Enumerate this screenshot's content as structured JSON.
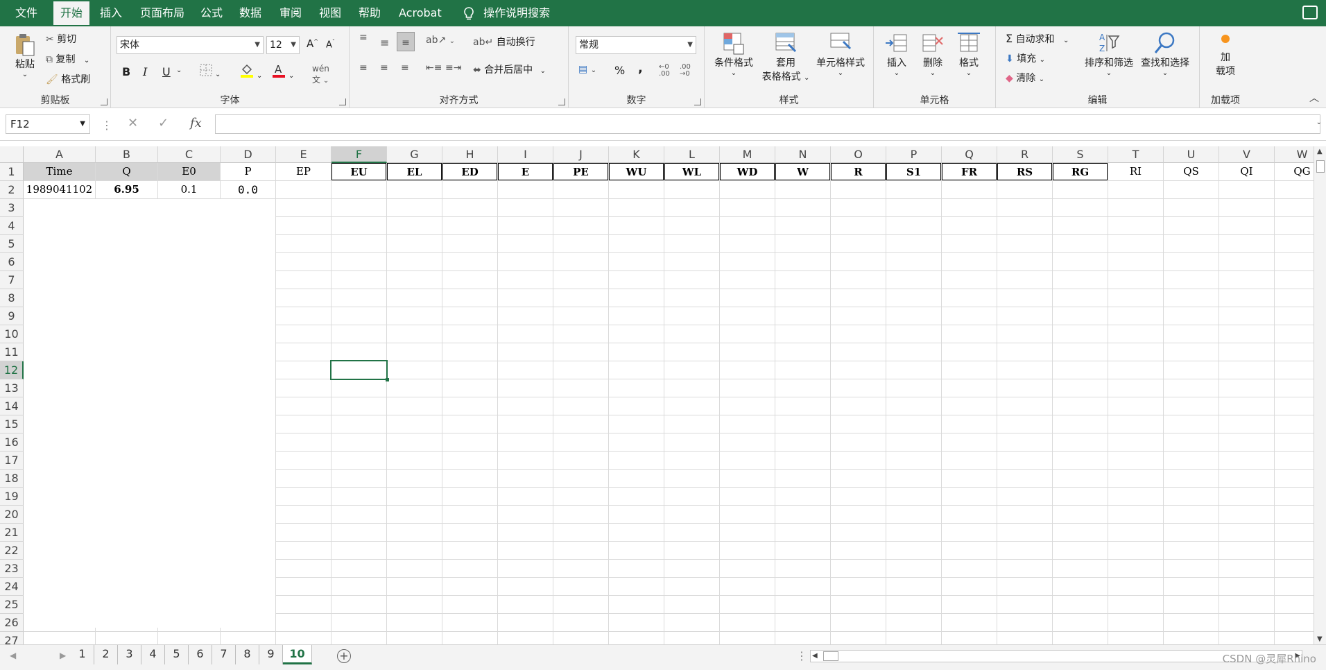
{
  "menu": {
    "tabs": [
      "文件",
      "开始",
      "插入",
      "页面布局",
      "公式",
      "数据",
      "审阅",
      "视图",
      "帮助",
      "Acrobat"
    ],
    "active": "开始",
    "tell_me": "操作说明搜索"
  },
  "ribbon": {
    "clipboard": {
      "paste": "粘贴",
      "cut": "剪切",
      "copy": "复制",
      "format_painter": "格式刷",
      "label": "剪贴板"
    },
    "font": {
      "name": "宋体",
      "size": "12",
      "bold": "B",
      "italic": "I",
      "underline": "U",
      "label": "字体"
    },
    "alignment": {
      "wrap": "自动换行",
      "merge": "合并后居中",
      "label": "对齐方式"
    },
    "number": {
      "format": "常规",
      "percent": "%",
      "comma": ",",
      "label": "数字"
    },
    "styles": {
      "conditional": "条件格式",
      "table_1": "套用",
      "table_2": "表格格式",
      "cell_styles": "单元格样式",
      "label": "样式"
    },
    "cells": {
      "insert": "插入",
      "delete": "删除",
      "format": "格式",
      "label": "单元格"
    },
    "editing": {
      "autosum": "自动求和",
      "fill": "填充",
      "clear": "清除",
      "sort": "排序和筛选",
      "find": "查找和选择",
      "label": "编辑"
    },
    "addins": {
      "btn_1": "加",
      "btn_2": "载项",
      "label": "加载项"
    }
  },
  "formula_bar": {
    "name_box": "F12",
    "fx": "fx",
    "value": ""
  },
  "grid": {
    "columns": [
      "A",
      "B",
      "C",
      "D",
      "E",
      "F",
      "G",
      "H",
      "I",
      "J",
      "K",
      "L",
      "M",
      "N",
      "O",
      "P",
      "Q",
      "R",
      "S",
      "T",
      "U",
      "V",
      "W"
    ],
    "selected_column": "F",
    "rows": [
      "1",
      "2",
      "3",
      "4",
      "5",
      "6",
      "7",
      "8",
      "9",
      "10",
      "11",
      "12",
      "13",
      "14",
      "15",
      "16",
      "17",
      "18",
      "19",
      "20",
      "21",
      "22",
      "23",
      "24",
      "25",
      "26",
      "27"
    ],
    "selected_row": "12",
    "header_row": [
      "Time",
      "Q",
      "E0",
      "P",
      "EP",
      "EU",
      "EL",
      "ED",
      "E",
      "PE",
      "WU",
      "WL",
      "WD",
      "W",
      "R",
      "S1",
      "FR",
      "RS",
      "RG",
      "RI",
      "QS",
      "QI",
      "QG"
    ],
    "row2": [
      "1989041102",
      "6.95",
      "0.1",
      "0.0"
    ]
  },
  "sheets": {
    "tabs": [
      "1",
      "2",
      "3",
      "4",
      "5",
      "6",
      "7",
      "8",
      "9",
      "10"
    ],
    "active": "10"
  },
  "watermark": "CSDN @灵犀Rhino"
}
